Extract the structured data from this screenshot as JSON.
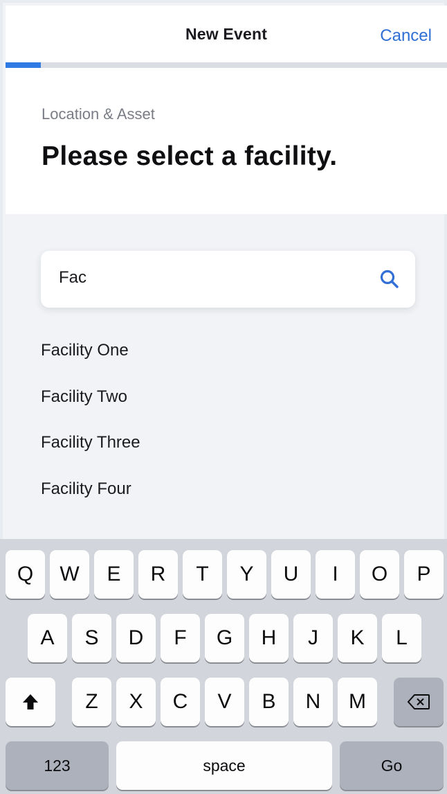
{
  "nav": {
    "title": "New Event",
    "cancel_label": "Cancel",
    "progress_fraction": 0.08
  },
  "section": {
    "subtitle": "Location & Asset",
    "headline": "Please select a facility."
  },
  "search": {
    "value": "Fac",
    "icon": "search-icon"
  },
  "results": [
    "Facility One",
    "Facility Two",
    "Facility Three",
    "Facility Four"
  ],
  "keyboard": {
    "row1": [
      "Q",
      "W",
      "E",
      "R",
      "T",
      "Y",
      "U",
      "I",
      "O",
      "P"
    ],
    "row2": [
      "A",
      "S",
      "D",
      "F",
      "G",
      "H",
      "J",
      "K",
      "L"
    ],
    "row3": [
      "Z",
      "X",
      "C",
      "V",
      "B",
      "N",
      "M"
    ],
    "shift_icon": "shift-arrow-icon",
    "delete_icon": "backspace-icon",
    "numbers_label": "123",
    "space_label": "space",
    "go_label": "Go"
  },
  "colors": {
    "accent": "#2f6fd6",
    "progress": "#2f7be3",
    "background": "#f1f3f6",
    "keyboard_bg": "#d2d5db"
  }
}
